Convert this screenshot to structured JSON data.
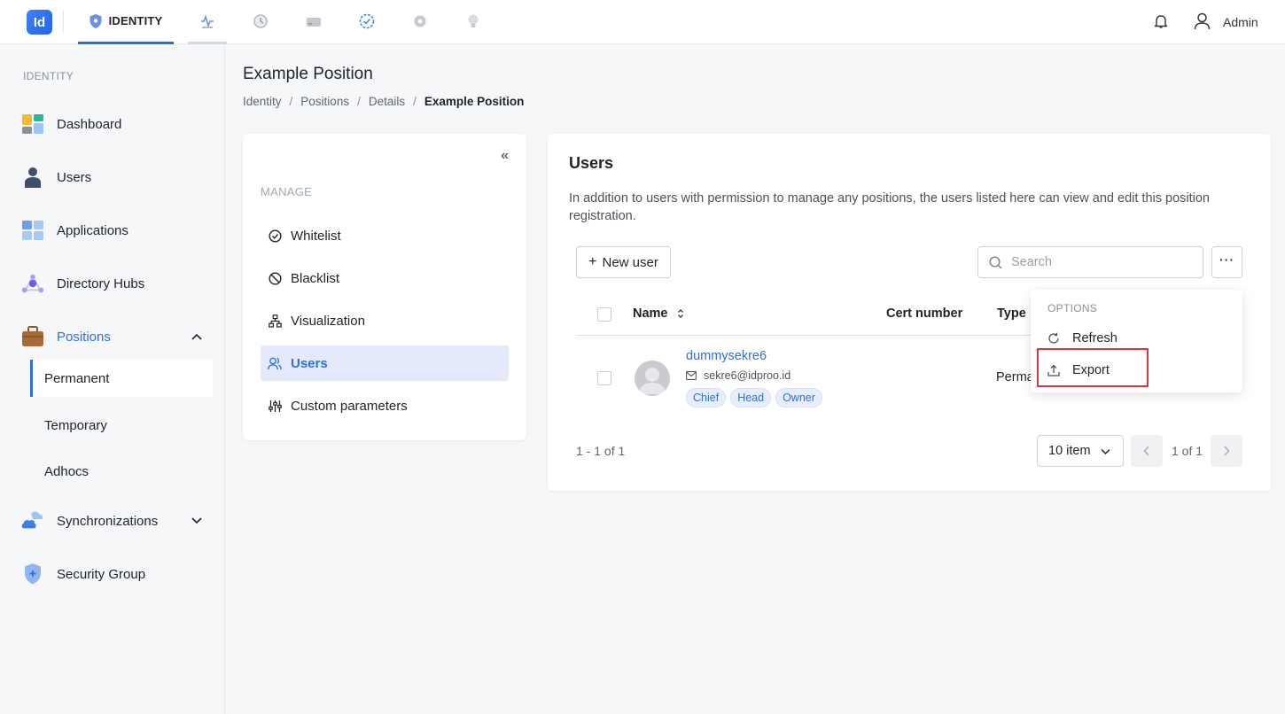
{
  "topbar": {
    "logo_text": "Id",
    "active_tab_label": "IDENTITY",
    "admin_label": "Admin",
    "accent_color": "#2f6fd6"
  },
  "sidebar": {
    "heading": "IDENTITY",
    "items": [
      {
        "label": "Dashboard",
        "icon": "dashboard-icon"
      },
      {
        "label": "Users",
        "icon": "users-icon"
      },
      {
        "label": "Applications",
        "icon": "applications-icon"
      },
      {
        "label": "Directory Hubs",
        "icon": "directory-hubs-icon"
      },
      {
        "label": "Positions",
        "icon": "positions-icon"
      },
      {
        "label": "Synchronizations",
        "icon": "synchronizations-icon"
      },
      {
        "label": "Security Group",
        "icon": "security-group-icon"
      }
    ],
    "positions_sub": [
      "Permanent",
      "Temporary",
      "Adhocs"
    ]
  },
  "page": {
    "title": "Example Position",
    "breadcrumb": [
      "Identity",
      "Positions",
      "Details",
      "Example Position"
    ]
  },
  "manage": {
    "collapse_label": "«",
    "heading": "MANAGE",
    "items": [
      "Whitelist",
      "Blacklist",
      "Visualization",
      "Users",
      "Custom parameters"
    ]
  },
  "users_panel": {
    "title": "Users",
    "description": "In addition to users with permission to manage any positions, the users listed here can view and edit this position registration.",
    "new_user_label": "New user",
    "search_placeholder": "Search",
    "more_label": "···",
    "columns": [
      "Name",
      "Cert number",
      "Type"
    ],
    "rows": [
      {
        "name": "dummysekre6",
        "email": "sekre6@idproo.id",
        "tags": [
          "Chief",
          "Head",
          "Owner"
        ],
        "cert_number": "",
        "type": "Perma"
      }
    ],
    "range_text": "1 - 1 of 1",
    "page_size": "10 item",
    "page_text": "1 of 1"
  },
  "options_menu": {
    "heading": "OPTIONS",
    "items": [
      "Refresh",
      "Export"
    ]
  }
}
